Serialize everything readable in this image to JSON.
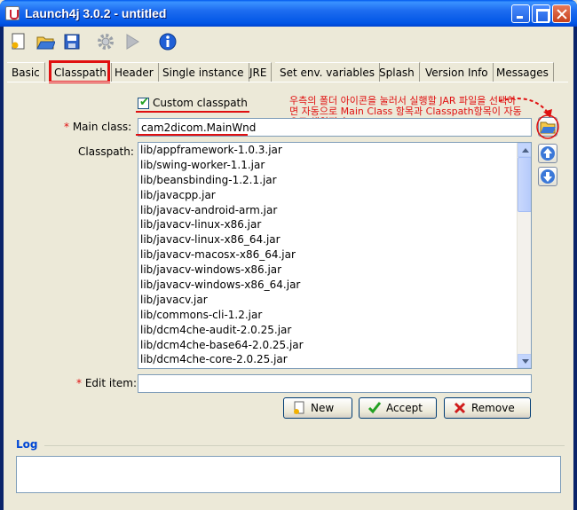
{
  "window": {
    "title": "Launch4j 3.0.2 - untitled"
  },
  "toolbar": {
    "icons": [
      "new-file-icon",
      "open-folder-icon",
      "save-icon",
      "build-gear-icon",
      "run-play-icon",
      "about-info-icon"
    ]
  },
  "tabs": [
    "Basic",
    "Classpath",
    "Header",
    "Single instance",
    "JRE",
    "Set env. variables",
    "Splash",
    "Version Info",
    "Messages"
  ],
  "active_tab": "Classpath",
  "custom_classpath": {
    "label": "Custom classpath",
    "checked": true
  },
  "main_class": {
    "label": "Main class:",
    "value": "cam2dicom.MainWnd"
  },
  "annotation": "우측의 폴더 아이콘을 눌러서 실행할 JAR 파일을 선택하면 자동으로 Main Class 항목과 Classpath항목이 자동으로 채워진다",
  "classpath": {
    "label": "Classpath:",
    "items": [
      "lib/appframework-1.0.3.jar",
      "lib/swing-worker-1.1.jar",
      "lib/beansbinding-1.2.1.jar",
      "lib/javacpp.jar",
      "lib/javacv-android-arm.jar",
      "lib/javacv-linux-x86.jar",
      "lib/javacv-linux-x86_64.jar",
      "lib/javacv-macosx-x86_64.jar",
      "lib/javacv-windows-x86.jar",
      "lib/javacv-windows-x86_64.jar",
      "lib/javacv.jar",
      "lib/commons-cli-1.2.jar",
      "lib/dcm4che-audit-2.0.25.jar",
      "lib/dcm4che-base64-2.0.25.jar",
      "lib/dcm4che-core-2.0.25.jar"
    ]
  },
  "edit_item": {
    "label": "Edit item:",
    "value": ""
  },
  "buttons": {
    "new": "New",
    "accept": "Accept",
    "remove": "Remove"
  },
  "log": {
    "label": "Log",
    "value": ""
  },
  "colors": {
    "title_bar": "#0055E5",
    "annotation": "#E01010",
    "log_label": "#0046D5"
  }
}
